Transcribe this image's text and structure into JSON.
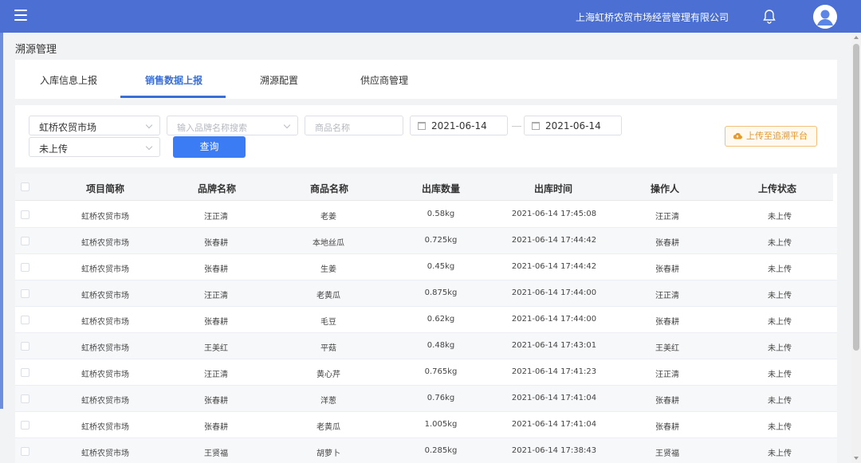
{
  "header": {
    "company": "上海虹桥农贸市场经营管理有限公司",
    "menu_icon": "hamburger-menu-icon",
    "bell_icon": "bell-icon",
    "avatar_icon": "user-avatar-icon",
    "color": "#4b6fd3"
  },
  "page": {
    "title": "溯源管理"
  },
  "tabs": [
    {
      "label": "入库信息上报",
      "active": false
    },
    {
      "label": "销售数据上报",
      "active": true
    },
    {
      "label": "溯源配置",
      "active": false
    },
    {
      "label": "供应商管理",
      "active": false
    }
  ],
  "filters": {
    "market_select": "虹桥农贸市场",
    "brand_search_placeholder": "输入品牌名称搜索",
    "product_name_placeholder": "商品名称",
    "date_start": "2021-06-14",
    "date_end": "2021-06-14",
    "status_select": "未上传",
    "query_label": "查询",
    "upload_label": "上传至追溯平台"
  },
  "table": {
    "columns": [
      "项目简称",
      "品牌名称",
      "商品名称",
      "出库数量",
      "出库时间",
      "操作人",
      "上传状态"
    ],
    "rows": [
      [
        "虹桥农贸市场",
        "汪正清",
        "老姜",
        "0.58kg",
        "2021-06-14 17:45:08",
        "汪正清",
        "未上传"
      ],
      [
        "虹桥农贸市场",
        "张春耕",
        "本地丝瓜",
        "0.725kg",
        "2021-06-14 17:44:42",
        "张春耕",
        "未上传"
      ],
      [
        "虹桥农贸市场",
        "张春耕",
        "生姜",
        "0.45kg",
        "2021-06-14 17:44:42",
        "张春耕",
        "未上传"
      ],
      [
        "虹桥农贸市场",
        "汪正清",
        "老黄瓜",
        "0.875kg",
        "2021-06-14 17:44:00",
        "汪正清",
        "未上传"
      ],
      [
        "虹桥农贸市场",
        "张春耕",
        "毛豆",
        "0.62kg",
        "2021-06-14 17:44:00",
        "张春耕",
        "未上传"
      ],
      [
        "虹桥农贸市场",
        "王美红",
        "平菇",
        "0.48kg",
        "2021-06-14 17:43:01",
        "王美红",
        "未上传"
      ],
      [
        "虹桥农贸市场",
        "汪正清",
        "黄心芹",
        "0.765kg",
        "2021-06-14 17:41:23",
        "汪正清",
        "未上传"
      ],
      [
        "虹桥农贸市场",
        "张春耕",
        "洋葱",
        "0.76kg",
        "2021-06-14 17:41:04",
        "张春耕",
        "未上传"
      ],
      [
        "虹桥农贸市场",
        "张春耕",
        "老黄瓜",
        "1.005kg",
        "2021-06-14 17:41:04",
        "张春耕",
        "未上传"
      ],
      [
        "虹桥农贸市场",
        "王贤福",
        "胡萝卜",
        "0.285kg",
        "2021-06-14 17:38:43",
        "王贤福",
        "未上传"
      ]
    ]
  }
}
